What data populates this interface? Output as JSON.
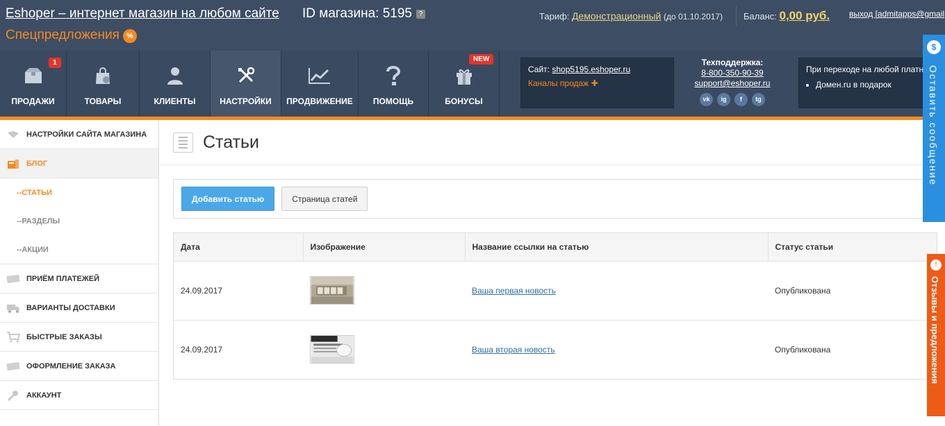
{
  "header": {
    "brand": "Eshoper – интернет магазин на любом сайте",
    "shop_id": "ID магазина: 5195",
    "help_glyph": "?",
    "special": "Спецпредложения",
    "special_icon": "%",
    "tariff_label": "Тариф:",
    "tariff_value": "Демонстрационный",
    "tariff_till": "(до 01.10.2017)",
    "balance_label": "Баланс:",
    "balance_value": "0,00 руб.",
    "logout": "выход [admitapps@gmail"
  },
  "nav": {
    "tabs": [
      {
        "label": "ПРОДАЖИ",
        "badge": "1"
      },
      {
        "label": "ТОВАРЫ"
      },
      {
        "label": "КЛИЕНТЫ"
      },
      {
        "label": "НАСТРОЙКИ",
        "active": true
      },
      {
        "label": "ПРОДВИЖЕНИЕ"
      },
      {
        "label": "ПОМОЩЬ"
      },
      {
        "label": "БОНУСЫ",
        "badge": "NEW"
      }
    ],
    "site_label": "Сайт:",
    "site_url": "shop5195.eshoper.ru",
    "channels": "Каналы продаж",
    "channels_plus": "✚",
    "support_title": "Техподдержка:",
    "support_phone": "8-800-350-90-39",
    "support_email": "support@eshoper.ru",
    "socials": [
      "vk",
      "ig",
      "f",
      "tg"
    ],
    "promo_title": "При переходе на любой платн",
    "promo_item": "Домен.ru в подарок"
  },
  "sidebar": {
    "items": [
      {
        "label": "НАСТРОЙКИ САЙТА МАГАЗИНА"
      },
      {
        "label": "БЛОГ",
        "active": true
      },
      {
        "label": "ПРИЁМ ПЛАТЕЖЕЙ"
      },
      {
        "label": "ВАРИАНТЫ ДОСТАВКИ"
      },
      {
        "label": "БЫСТРЫЕ ЗАКАЗЫ"
      },
      {
        "label": "ОФОРМЛЕНИЕ ЗАКАЗА"
      },
      {
        "label": "АККАУНТ"
      }
    ],
    "subitems": [
      {
        "label": "--СТАТЬИ",
        "active": true
      },
      {
        "label": "--РАЗДЕЛЫ"
      },
      {
        "label": "--АКЦИИ"
      }
    ]
  },
  "main": {
    "title": "Статьи",
    "add_button": "Добавить статью",
    "page_button": "Страница статей",
    "columns": [
      "Дата",
      "Изображение",
      "Название ссылки на статью",
      "Статус статьи"
    ],
    "rows": [
      {
        "date": "24.09.2017",
        "link": "Ваша первая новость",
        "status": "Опубликована"
      },
      {
        "date": "24.09.2017",
        "link": "Ваша вторая новость",
        "status": "Опубликована"
      }
    ]
  },
  "side_tabs": {
    "message": "Оставить сообщение",
    "message_icon": "$",
    "feedback": "Отзывы и предложения",
    "feedback_icon": "!"
  },
  "colors": {
    "accent": "#f58a1f",
    "header": "#3d4d63",
    "button": "#4ba8e8",
    "message_tab": "#2b8fe0",
    "feedback_tab": "#ee5b17"
  }
}
